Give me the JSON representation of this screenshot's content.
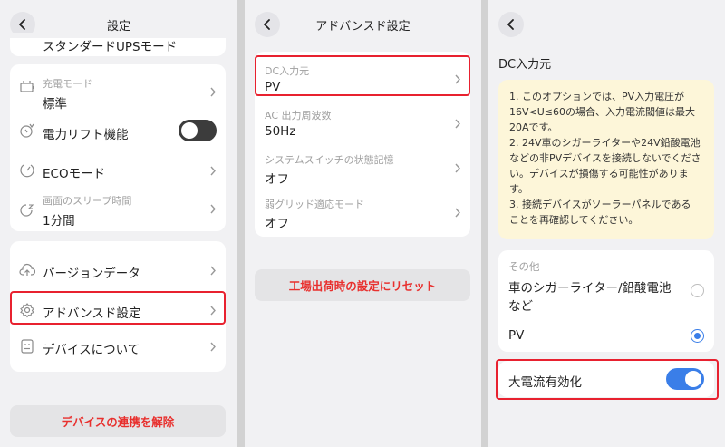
{
  "panel1": {
    "title": "設定",
    "top_partial": "スタンダードUPSモード",
    "charge_mode": {
      "label": "充電モード",
      "value": "標準"
    },
    "power_lift": {
      "label": "電力リフト機能",
      "toggle": "off"
    },
    "eco_mode": {
      "label": "ECOモード"
    },
    "screen_sleep": {
      "label": "画面のスリープ時間",
      "value": "1分間"
    },
    "version": {
      "label": "バージョンデータ"
    },
    "advanced": {
      "label": "アドバンスド設定"
    },
    "about": {
      "label": "デバイスについて"
    },
    "unlink_button": "デバイスの連携を解除"
  },
  "panel2": {
    "title": "アドバンスド設定",
    "items": [
      {
        "label": "DC入力元",
        "value": "PV"
      },
      {
        "label": "AC 出力周波数",
        "value": "50Hz"
      },
      {
        "label": "システムスイッチの状態記憶",
        "value": "オフ"
      },
      {
        "label": "弱グリッド適応モード",
        "value": "オフ"
      }
    ],
    "reset_button": "工場出荷時の設定にリセット"
  },
  "panel3": {
    "section_title": "DC入力元",
    "note_lines": [
      "1. このオプションでは、PV入力電圧が",
      "16V<U≤60の場合、入力電流閾値は最大",
      "20Aです。",
      "2. 24V車のシガーライターや24V鉛酸電池",
      "などの非PVデバイスを接続しないでくださ",
      "い。デバイスが損傷する可能性がありま",
      "す。",
      "3. 接続デバイスがソーラーパネルである",
      "ことを再確認してください。"
    ],
    "group_label": "その他",
    "option_other_line1": "車のシガーライター/鉛酸電池",
    "option_other_line2": "など",
    "option_pv": "PV",
    "selected": "PV",
    "high_current": {
      "label": "大電流有効化",
      "toggle": "on"
    }
  },
  "colors": {
    "accent_blue": "#3a7ee8",
    "highlight_red": "#e8212f",
    "toggle_off": "#3c3c3c",
    "note_bg": "#fdf6d9"
  },
  "icons": [
    "back-arrow-icon",
    "chevron-right-icon",
    "battery-charge-icon",
    "power-lift-icon",
    "eco-icon",
    "sleep-timer-icon",
    "cloud-upload-icon",
    "gear-icon",
    "device-info-icon"
  ]
}
